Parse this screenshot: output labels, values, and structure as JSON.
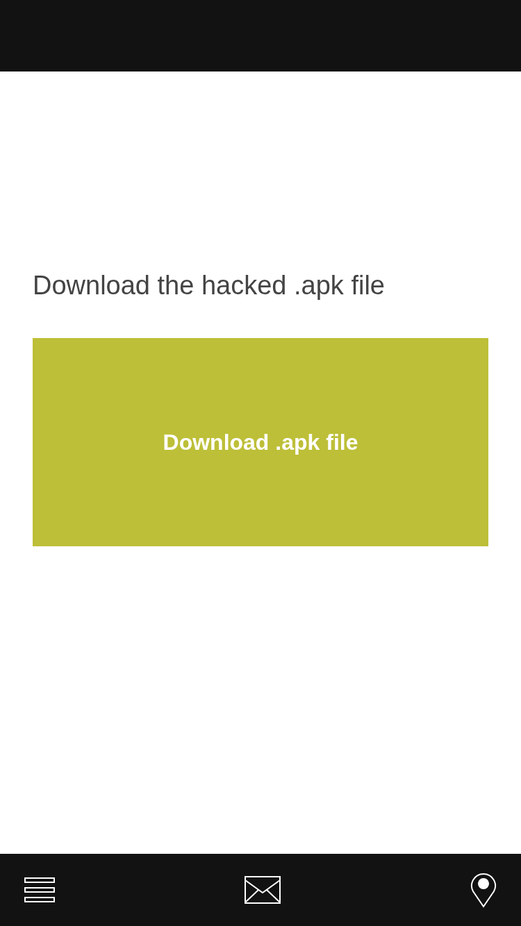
{
  "heading": "Download the hacked .apk file",
  "download_button": {
    "label": "Download .apk file"
  }
}
